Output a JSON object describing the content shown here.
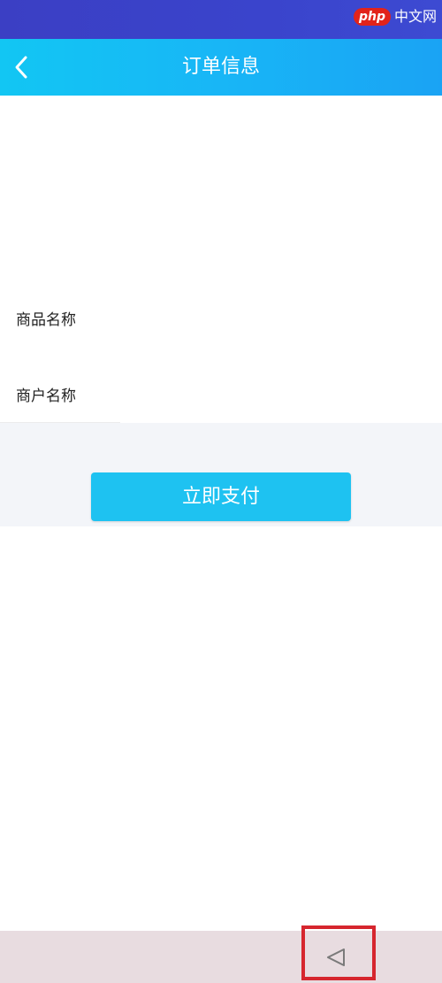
{
  "status_bar": {
    "watermark_badge": "php",
    "watermark_text": "中文网"
  },
  "header": {
    "title": "订单信息",
    "back_icon": "chevron-left-icon"
  },
  "form": {
    "product_name_label": "商品名称",
    "merchant_name_label": "商户名称"
  },
  "actions": {
    "pay_label": "立即支付"
  },
  "nav": {
    "back_icon": "triangle-back-icon"
  },
  "colors": {
    "header_gradient_start": "#12c6f3",
    "header_gradient_end": "#1aa3f4",
    "status_bar": "#3b3fc4",
    "pay_button": "#1ec2f1",
    "highlight": "#d6262e"
  }
}
